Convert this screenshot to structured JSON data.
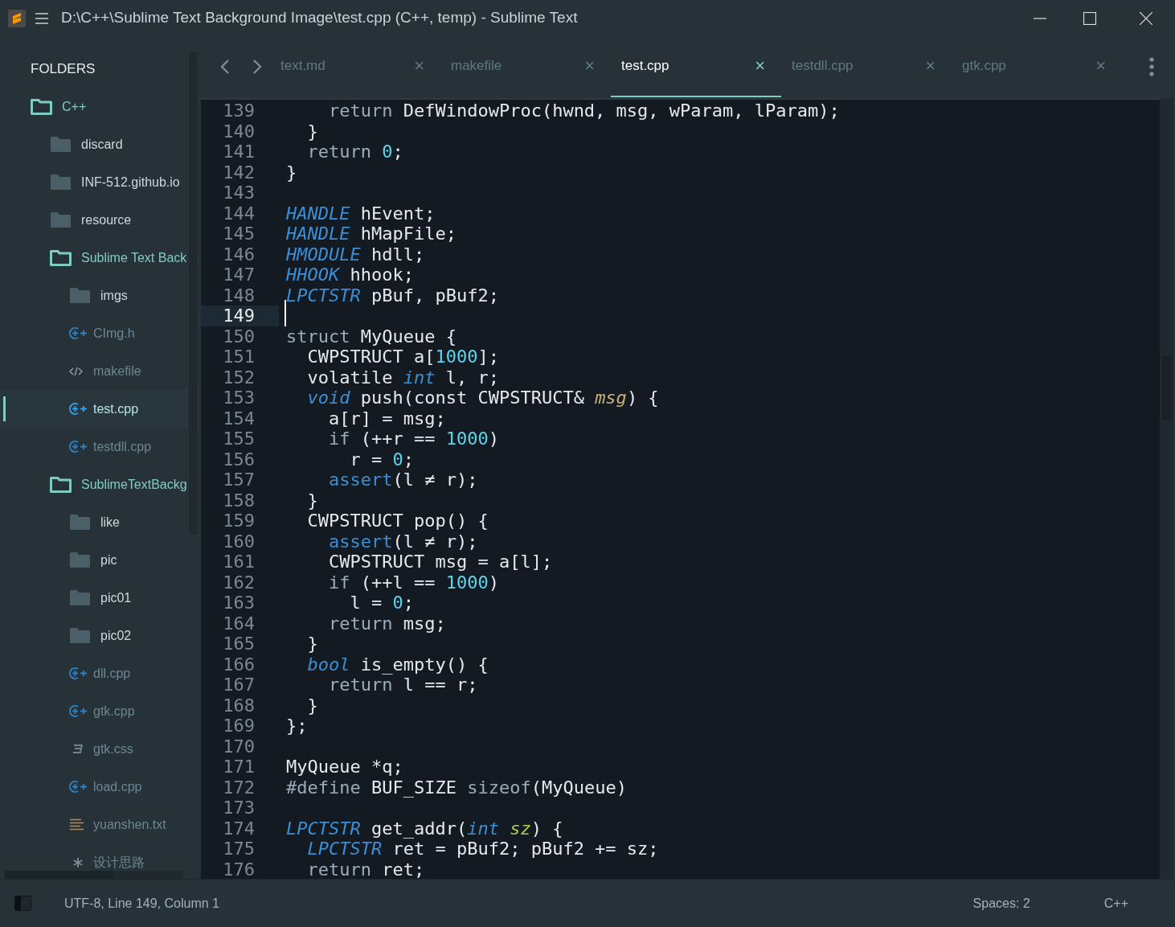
{
  "window": {
    "title": "D:\\C++\\Sublime Text Background Image\\test.cpp (C++, temp) - Sublime Text"
  },
  "sidebar": {
    "header": "FOLDERS",
    "tree": [
      {
        "name": "C++",
        "kind": "folder",
        "expanded": true,
        "selected": false,
        "children": [
          {
            "name": "discard",
            "kind": "folder",
            "expanded": false,
            "selected": false
          },
          {
            "name": "INF-512.github.io",
            "kind": "folder",
            "expanded": false,
            "selected": false
          },
          {
            "name": "resource",
            "kind": "folder",
            "expanded": false,
            "selected": false
          },
          {
            "name": "Sublime Text Back",
            "kind": "folder",
            "expanded": true,
            "selected": false,
            "children": [
              {
                "name": "imgs",
                "kind": "folder",
                "expanded": false,
                "selected": false
              },
              {
                "name": "CImg.h",
                "kind": "cpp",
                "selected": false
              },
              {
                "name": "makefile",
                "kind": "makefile",
                "selected": false
              },
              {
                "name": "test.cpp",
                "kind": "cpp",
                "selected": true
              },
              {
                "name": "testdll.cpp",
                "kind": "cpp",
                "selected": false
              }
            ]
          },
          {
            "name": "SublimeTextBackg",
            "kind": "folder",
            "expanded": true,
            "selected": false,
            "children": [
              {
                "name": "like",
                "kind": "folder",
                "expanded": false,
                "selected": false
              },
              {
                "name": "pic",
                "kind": "folder",
                "expanded": false,
                "selected": false
              },
              {
                "name": "pic01",
                "kind": "folder",
                "expanded": false,
                "selected": false
              },
              {
                "name": "pic02",
                "kind": "folder",
                "expanded": false,
                "selected": false
              },
              {
                "name": "dll.cpp",
                "kind": "cpp",
                "selected": false
              },
              {
                "name": "gtk.cpp",
                "kind": "cpp",
                "selected": false
              },
              {
                "name": "gtk.css",
                "kind": "css",
                "selected": false
              },
              {
                "name": "load.cpp",
                "kind": "cpp",
                "selected": false
              },
              {
                "name": "yuanshen.txt",
                "kind": "text",
                "selected": false
              },
              {
                "name": "设计思路",
                "kind": "other",
                "selected": false
              }
            ]
          }
        ]
      }
    ]
  },
  "tabs": [
    {
      "label": "text.md",
      "close": "×",
      "selected": false
    },
    {
      "label": "makefile",
      "close": "×",
      "selected": false
    },
    {
      "label": "test.cpp",
      "close": "×",
      "selected": true
    },
    {
      "label": "testdll.cpp",
      "close": "×",
      "selected": false
    },
    {
      "label": "gtk.cpp",
      "close": "×",
      "selected": false
    }
  ],
  "editor": {
    "lines": [
      {
        "number": "139",
        "current": false,
        "tokens": [
          {
            "kind": "kw",
            "text": "    return "
          },
          {
            "kind": "plain",
            "text": "DefWindowProc(hwnd, msg, wParam, lParam);"
          }
        ]
      },
      {
        "number": "140",
        "current": false,
        "tokens": [
          {
            "kind": "plain",
            "text": "  }"
          }
        ]
      },
      {
        "number": "141",
        "current": false,
        "tokens": [
          {
            "kind": "kw",
            "text": "  return "
          },
          {
            "kind": "num",
            "text": "0"
          },
          {
            "kind": "plain",
            "text": ";"
          }
        ]
      },
      {
        "number": "142",
        "current": false,
        "tokens": [
          {
            "kind": "plain",
            "text": "}"
          }
        ]
      },
      {
        "number": "143",
        "current": false
      },
      {
        "number": "144",
        "current": false,
        "tokens": [
          {
            "kind": "type",
            "text": "HANDLE"
          },
          {
            "kind": "plain",
            "text": " hEvent;"
          }
        ]
      },
      {
        "number": "145",
        "current": false,
        "tokens": [
          {
            "kind": "type",
            "text": "HANDLE"
          },
          {
            "kind": "plain",
            "text": " hMapFile;"
          }
        ]
      },
      {
        "number": "146",
        "current": false,
        "tokens": [
          {
            "kind": "type",
            "text": "HMODULE"
          },
          {
            "kind": "plain",
            "text": " hdll;"
          }
        ]
      },
      {
        "number": "147",
        "current": false,
        "tokens": [
          {
            "kind": "type",
            "text": "HHOOK"
          },
          {
            "kind": "plain",
            "text": " hhook;"
          }
        ]
      },
      {
        "number": "148",
        "current": false,
        "tokens": [
          {
            "kind": "type",
            "text": "LPCTSTR"
          },
          {
            "kind": "plain",
            "text": " pBuf, pBuf2;"
          }
        ]
      },
      {
        "number": "149",
        "current": true
      },
      {
        "number": "150",
        "current": false,
        "tokens": [
          {
            "kind": "kw",
            "text": "struct "
          },
          {
            "kind": "plain",
            "text": "MyQueue {"
          }
        ]
      },
      {
        "number": "151",
        "current": false,
        "tokens": [
          {
            "kind": "plain",
            "text": "  CWPSTRUCT a["
          },
          {
            "kind": "num",
            "text": "1000"
          },
          {
            "kind": "plain",
            "text": "];"
          }
        ]
      },
      {
        "number": "152",
        "current": false,
        "tokens": [
          {
            "kind": "plain",
            "text": "  volatile "
          },
          {
            "kind": "type",
            "text": "int"
          },
          {
            "kind": "plain",
            "text": " l, r;"
          }
        ]
      },
      {
        "number": "153",
        "current": false,
        "tokens": [
          {
            "kind": "type",
            "text": "  void"
          },
          {
            "kind": "plain",
            "text": " push(const CWPSTRUCT& "
          },
          {
            "kind": "param",
            "text": "msg"
          },
          {
            "kind": "plain",
            "text": ") {"
          }
        ]
      },
      {
        "number": "154",
        "current": false,
        "tokens": [
          {
            "kind": "plain",
            "text": "    a[r] = msg;"
          }
        ]
      },
      {
        "number": "155",
        "current": false,
        "tokens": [
          {
            "kind": "kw",
            "text": "    if "
          },
          {
            "kind": "plain",
            "text": "(++r == "
          },
          {
            "kind": "num",
            "text": "1000"
          },
          {
            "kind": "plain",
            "text": ")"
          }
        ]
      },
      {
        "number": "156",
        "current": false,
        "tokens": [
          {
            "kind": "plain",
            "text": "      r = "
          },
          {
            "kind": "num",
            "text": "0"
          },
          {
            "kind": "plain",
            "text": ";"
          }
        ]
      },
      {
        "number": "157",
        "current": false,
        "tokens": [
          {
            "kind": "call",
            "text": "    assert"
          },
          {
            "kind": "plain",
            "text": "(l ≠ r);"
          }
        ]
      },
      {
        "number": "158",
        "current": false,
        "tokens": [
          {
            "kind": "plain",
            "text": "  }"
          }
        ]
      },
      {
        "number": "159",
        "current": false,
        "tokens": [
          {
            "kind": "plain",
            "text": "  CWPSTRUCT pop() {"
          }
        ]
      },
      {
        "number": "160",
        "current": false,
        "tokens": [
          {
            "kind": "call",
            "text": "    assert"
          },
          {
            "kind": "plain",
            "text": "(l ≠ r);"
          }
        ]
      },
      {
        "number": "161",
        "current": false,
        "tokens": [
          {
            "kind": "plain",
            "text": "    CWPSTRUCT msg = a[l];"
          }
        ]
      },
      {
        "number": "162",
        "current": false,
        "tokens": [
          {
            "kind": "kw",
            "text": "    if "
          },
          {
            "kind": "plain",
            "text": "(++l == "
          },
          {
            "kind": "num",
            "text": "1000"
          },
          {
            "kind": "plain",
            "text": ")"
          }
        ]
      },
      {
        "number": "163",
        "current": false,
        "tokens": [
          {
            "kind": "plain",
            "text": "      l = "
          },
          {
            "kind": "num",
            "text": "0"
          },
          {
            "kind": "plain",
            "text": ";"
          }
        ]
      },
      {
        "number": "164",
        "current": false,
        "tokens": [
          {
            "kind": "kw",
            "text": "    return "
          },
          {
            "kind": "plain",
            "text": "msg;"
          }
        ]
      },
      {
        "number": "165",
        "current": false,
        "tokens": [
          {
            "kind": "plain",
            "text": "  }"
          }
        ]
      },
      {
        "number": "166",
        "current": false,
        "tokens": [
          {
            "kind": "type",
            "text": "  bool"
          },
          {
            "kind": "plain",
            "text": " is_empty() {"
          }
        ]
      },
      {
        "number": "167",
        "current": false,
        "tokens": [
          {
            "kind": "kw",
            "text": "    return "
          },
          {
            "kind": "plain",
            "text": "l == r;"
          }
        ]
      },
      {
        "number": "168",
        "current": false,
        "tokens": [
          {
            "kind": "plain",
            "text": "  }"
          }
        ]
      },
      {
        "number": "169",
        "current": false,
        "tokens": [
          {
            "kind": "plain",
            "text": "};"
          }
        ]
      },
      {
        "number": "170",
        "current": false
      },
      {
        "number": "171",
        "current": false,
        "tokens": [
          {
            "kind": "plain",
            "text": "MyQueue *q;"
          }
        ]
      },
      {
        "number": "172",
        "current": false,
        "tokens": [
          {
            "kind": "kw",
            "text": "#define "
          },
          {
            "kind": "plain",
            "text": "BUF_SIZE "
          },
          {
            "kind": "kw",
            "text": "sizeof"
          },
          {
            "kind": "plain",
            "text": "(MyQueue)"
          }
        ]
      },
      {
        "number": "173",
        "current": false
      },
      {
        "number": "174",
        "current": false,
        "tokens": [
          {
            "kind": "type",
            "text": "LPCTSTR"
          },
          {
            "kind": "plain",
            "text": " get_addr("
          },
          {
            "kind": "type",
            "text": "int "
          },
          {
            "kind": "param2",
            "text": "sz"
          },
          {
            "kind": "plain",
            "text": ") {"
          }
        ]
      },
      {
        "number": "175",
        "current": false,
        "tokens": [
          {
            "kind": "type",
            "text": "  LPCTSTR"
          },
          {
            "kind": "plain",
            "text": " ret = pBuf2; pBuf2 += sz;"
          }
        ]
      },
      {
        "number": "176",
        "current": false,
        "tokens": [
          {
            "kind": "kw",
            "text": "  return "
          },
          {
            "kind": "plain",
            "text": "ret;"
          }
        ]
      }
    ]
  },
  "status_bar": {
    "position": "UTF-8, Line 149, Column 1",
    "indentation": "Spaces: 2",
    "syntax": "C++"
  }
}
